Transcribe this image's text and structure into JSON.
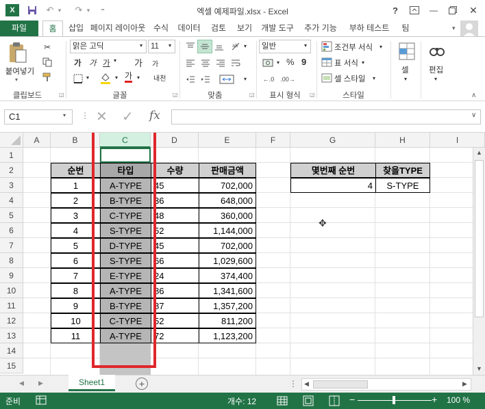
{
  "window": {
    "title": "엑셀 예제파일.xlsx - Excel",
    "help": "?",
    "minimize": "—",
    "close": "✕"
  },
  "qat": {
    "undo_arrow": "▾",
    "redo_arrow": "▾",
    "customize": "⁼"
  },
  "tabs": [
    "파일",
    "홈",
    "삽입",
    "페이지 레이아웃",
    "수식",
    "데이터",
    "검토",
    "보기",
    "개발 도구",
    "추가 기능",
    "부하 테스트",
    "팀"
  ],
  "ribbon": {
    "clipboard": {
      "label": "클립보드",
      "paste": "붙여넣기"
    },
    "font": {
      "label": "글꼴",
      "name": "맑은 고딕",
      "size": "11",
      "bold": "가",
      "italic": "가",
      "underline": "가",
      "grow": "가",
      "shrink": "가",
      "phonetic": "내천"
    },
    "alignment": {
      "label": "맞춤"
    },
    "number": {
      "label": "표시 형식",
      "format": "일반",
      "percent": "%",
      "comma": "9"
    },
    "styles": {
      "label": "스타일",
      "conditional": "조건부 서식",
      "table": "표 서식",
      "cell": "셀 스타일"
    },
    "cells": {
      "label": "셀"
    },
    "editing": {
      "label": "편집"
    }
  },
  "formula_bar": {
    "name_box": "C1",
    "fx": "fx",
    "value": ""
  },
  "grid": {
    "columns": [
      "A",
      "B",
      "C",
      "D",
      "E",
      "F",
      "G",
      "H",
      "I"
    ],
    "rows": [
      "1",
      "2",
      "3",
      "4",
      "5",
      "6",
      "7",
      "8",
      "9",
      "10",
      "11",
      "12",
      "13",
      "14",
      "15"
    ],
    "table": {
      "headers": [
        "순번",
        "타입",
        "수량",
        "판매금액"
      ],
      "rows": [
        [
          "1",
          "A-TYPE",
          "45",
          "702,000"
        ],
        [
          "2",
          "B-TYPE",
          "36",
          "648,000"
        ],
        [
          "3",
          "C-TYPE",
          "48",
          "360,000"
        ],
        [
          "4",
          "S-TYPE",
          "52",
          "1,144,000"
        ],
        [
          "5",
          "D-TYPE",
          "45",
          "702,000"
        ],
        [
          "6",
          "S-TYPE",
          "66",
          "1,029,600"
        ],
        [
          "7",
          "E-TYPE",
          "24",
          "374,400"
        ],
        [
          "8",
          "A-TYPE",
          "86",
          "1,341,600"
        ],
        [
          "9",
          "B-TYPE",
          "87",
          "1,357,200"
        ],
        [
          "10",
          "C-TYPE",
          "52",
          "811,200"
        ],
        [
          "11",
          "A-TYPE",
          "72",
          "1,123,200"
        ]
      ]
    },
    "lookup": {
      "header_nth": "몇번째 순번",
      "header_type": "찾을TYPE",
      "value_nth": "4",
      "value_type": "S-TYPE"
    }
  },
  "sheets": {
    "active": "Sheet1",
    "add": "+"
  },
  "status": {
    "mode": "준비",
    "count": "개수: 12",
    "zoom": "100 %",
    "zoom_minus": "−",
    "zoom_plus": "+"
  },
  "colors": {
    "excel_green": "#217346",
    "highlight_red": "#e0262a",
    "selected_fill": "#c4c4c4"
  }
}
